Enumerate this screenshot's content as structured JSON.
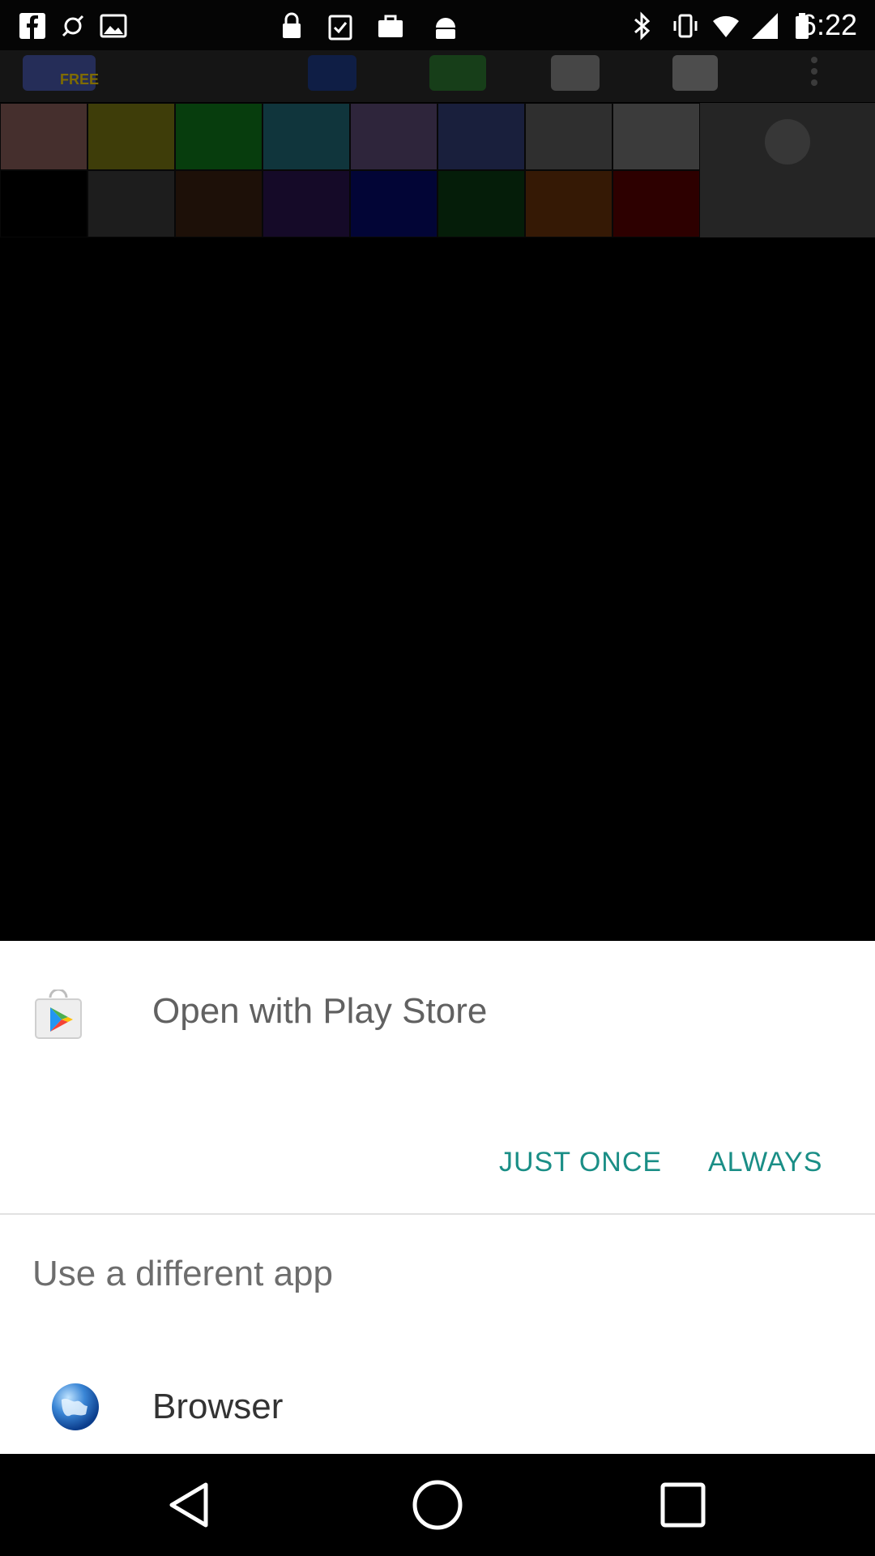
{
  "status_bar": {
    "time": "6:22",
    "left_icons": [
      "facebook-icon",
      "fake-gps-icon",
      "image-icon",
      "lock-icon",
      "clipboard-check-icon",
      "briefcase-icon",
      "android-icon"
    ],
    "right_icons": [
      "bluetooth-icon",
      "vibrate-icon",
      "wifi-icon",
      "signal-icon",
      "battery-icon"
    ]
  },
  "background_app": {
    "badge": "FREE",
    "swatch_colors_row1": [
      "#8a5f5a",
      "#7c7a12",
      "#0f7a1a",
      "#206a78",
      "#5d4b76",
      "#323e78",
      "#5e5e5e",
      "#777777"
    ],
    "swatch_colors_row2": [
      "#000000",
      "#3a3a3a",
      "#3b2110",
      "#2a1550",
      "#040a6c",
      "#0b3a12",
      "#6a330b",
      "#5a0000"
    ]
  },
  "dialog": {
    "title": "Open with Play Store",
    "app_icon": "play-store-icon",
    "just_once_label": "JUST ONCE",
    "always_label": "ALWAYS",
    "accent_color": "#1a8e86",
    "use_different_app_label": "Use a different app",
    "apps": [
      {
        "label": "Browser",
        "icon": "globe-icon"
      }
    ]
  },
  "nav_bar": {
    "icons": [
      "back-icon",
      "home-icon",
      "recents-icon"
    ]
  }
}
